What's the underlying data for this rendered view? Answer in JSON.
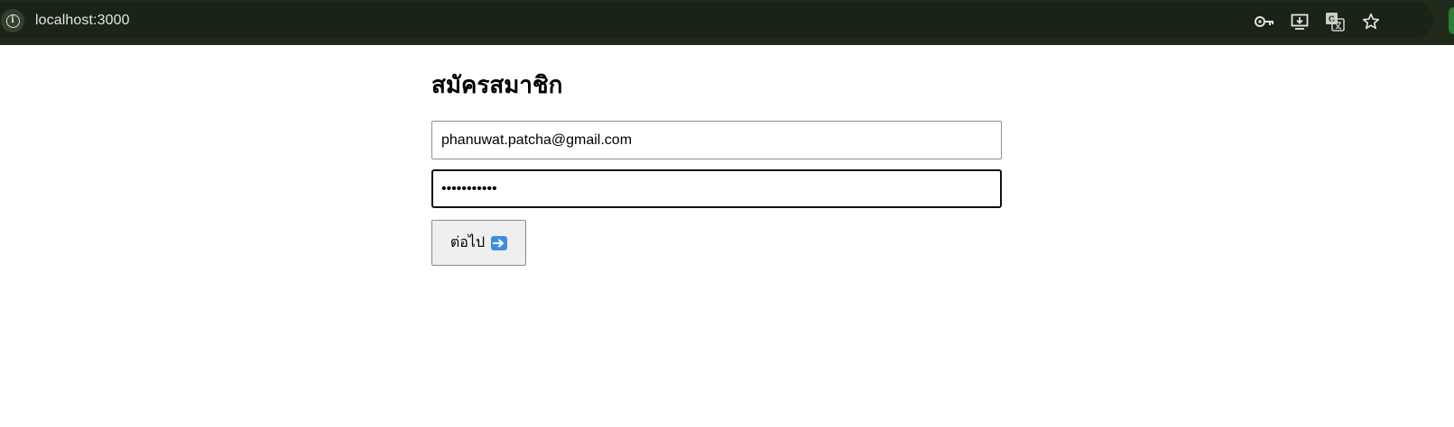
{
  "browser": {
    "url": "localhost:3000",
    "icons": [
      "site-info-icon",
      "key-icon",
      "install-app-icon",
      "translate-icon",
      "star-bookmark-icon"
    ],
    "theme_colors": {
      "bar": "#1f2a1b",
      "text": "#e3e6df"
    }
  },
  "form": {
    "title": "สมัครสมาชิก",
    "email_value": "phanuwat.patcha@gmail.com",
    "password_value": "abcdefghijk",
    "next_label": "ต่อไป"
  },
  "icons": {
    "next_arrow": "right-arrow-emoji-icon"
  }
}
